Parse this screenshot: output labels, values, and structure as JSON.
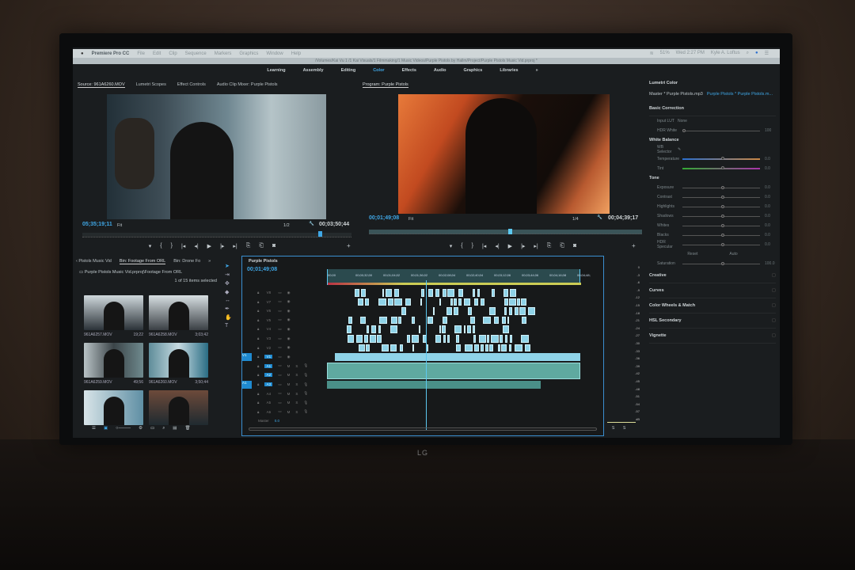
{
  "menubar": {
    "app": "Premiere Pro CC",
    "items": [
      "File",
      "Edit",
      "Clip",
      "Sequence",
      "Markers",
      "Graphics",
      "Window",
      "Help"
    ],
    "battery": "51%",
    "clock": "Wed 2:27 PM",
    "user": "Kyle A. Loftus"
  },
  "path": "/Volumes/Kai Vu 1 /1 Kai Visuals/1 Filmmaking/1 Music Videos/Purple Pistols by Hallm/Project/Purple Pistols Music Vid.prproj *",
  "workspaces": {
    "items": [
      "Learning",
      "Assembly",
      "Editing",
      "Color",
      "Effects",
      "Audio",
      "Graphics",
      "Libraries"
    ],
    "active": "Color",
    "more": "»"
  },
  "source": {
    "tabs": [
      "Source: 961A6260.MOV",
      "Lumetri Scopes",
      "Effect Controls",
      "Audio Clip Mixer: Purple Pistols"
    ],
    "timecode": "05;35;19;11",
    "fit": "Fit",
    "resolution": "1/2",
    "duration": "00;03;50;44"
  },
  "program": {
    "title": "Program: Purple Pistols",
    "timecode": "00;01;49;08",
    "fit": "Fit",
    "resolution": "1/4",
    "duration": "00;04;39;17"
  },
  "transport": {
    "buttons": [
      "▾",
      "{",
      "}",
      "|◂",
      "◂|",
      "▶",
      "|▸",
      "▸|",
      "⎘",
      "⎗",
      "◙"
    ],
    "add": "+"
  },
  "lumetri": {
    "title": "Lumetri Color",
    "master": "Master * Purple Pistols.mp3",
    "clip": "Purple Pistols * Purple Pistols.m...",
    "basic": "Basic Correction",
    "input_lut": "Input LUT",
    "input_lut_value": "None",
    "hdr_white": "HDR White",
    "hdr_white_value": "100",
    "white_balance": "White Balance",
    "wb_selector": "WB Selector",
    "wb_sliders": [
      {
        "label": "Temperature",
        "value": "0.0"
      },
      {
        "label": "Tint",
        "value": "0.0"
      }
    ],
    "tone": "Tone",
    "tone_sliders": [
      {
        "label": "Exposure",
        "value": "0.0"
      },
      {
        "label": "Contrast",
        "value": "0.0"
      },
      {
        "label": "Highlights",
        "value": "0.0"
      },
      {
        "label": "Shadows",
        "value": "0.0"
      },
      {
        "label": "Whites",
        "value": "0.0"
      },
      {
        "label": "Blacks",
        "value": "0.0"
      },
      {
        "label": "HDR Specular",
        "value": "0.0"
      }
    ],
    "reset": "Reset",
    "auto": "Auto",
    "saturation": "Saturation",
    "saturation_value": "100.0",
    "sections": [
      "Creative",
      "Curves",
      "Color Wheels & Match",
      "HSL Secondary",
      "Vignette"
    ]
  },
  "project": {
    "tabs": [
      "‹ Pistols Music Vid",
      "Bin: Footage From ORL",
      "Bin: Drone Fo"
    ],
    "more": "»",
    "path": "Purple Pistols Music Vid.prproj\\Footage From ORL",
    "selection": "1 of 15 items selected",
    "clips": [
      {
        "name": "961A6257.MOV",
        "duration": "19;22"
      },
      {
        "name": "961A6258.MOV",
        "duration": "3;03;42"
      },
      {
        "name": "961A6259.MOV",
        "duration": "49;56"
      },
      {
        "name": "961A6260.MOV",
        "duration": "3;50;44"
      },
      {
        "name": "",
        "duration": ""
      },
      {
        "name": "",
        "duration": ""
      }
    ]
  },
  "timeline": {
    "title": "Purple Pistols",
    "timecode": "00;01;49;08",
    "ruler": [
      "00;00",
      "00;00;32;00",
      "00;01;04;02",
      "00;01;36;02",
      "00;02;08;04",
      "00;02;40;04",
      "00;03;12;06",
      "00;03;44;06",
      "00;04;16;08",
      "00;04;48;"
    ],
    "video_tracks": [
      "V8",
      "V7",
      "V6",
      "V5",
      "V4",
      "V3",
      "V2",
      "V1"
    ],
    "audio_tracks": [
      "A1",
      "A2",
      "A3",
      "A4",
      "A5",
      "A6"
    ],
    "master": "Master",
    "master_value": "0.0"
  },
  "meter": {
    "labels": [
      "0",
      "-3",
      "-6",
      "-9",
      "-12",
      "-15",
      "-18",
      "-21",
      "-24",
      "-27",
      "-30",
      "-33",
      "-36",
      "-39",
      "-42",
      "-45",
      "-48",
      "-51",
      "-54",
      "-57",
      "dB"
    ],
    "channels": [
      "S",
      "S"
    ]
  },
  "brand": "LG",
  "colors": {
    "accent": "#3fa7e6",
    "clip_video": "#8fd3e8",
    "clip_audio": "#5fa9a0",
    "panel": "#1a1d1f"
  }
}
